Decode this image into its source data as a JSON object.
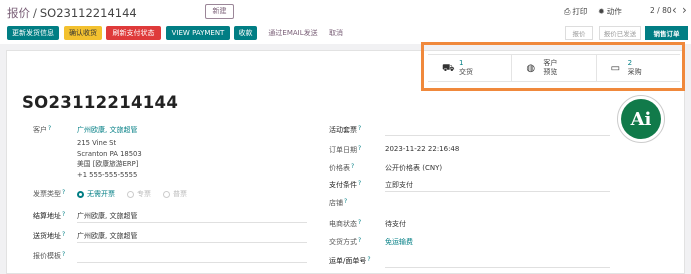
{
  "breadcrumb": {
    "parent": "报价",
    "sep": "/",
    "current": "SO23112214144"
  },
  "new_button": "新建",
  "toolbar": {
    "print_icon": "printer-icon",
    "print": "打印",
    "action_icon": "gear-icon",
    "action": "动作",
    "pager": "2 / 80"
  },
  "actions": [
    {
      "label": "更新发货信息",
      "style": "teal"
    },
    {
      "label": "确认收货",
      "style": "yellow"
    },
    {
      "label": "刷新支付状态",
      "style": "red"
    },
    {
      "label": "VIEW PAYMENT",
      "style": "teal"
    },
    {
      "label": "收款",
      "style": "teal"
    },
    {
      "label": "通过EMAIL发送",
      "style": "plain"
    },
    {
      "label": "取消",
      "style": "plain"
    }
  ],
  "statusbar": {
    "quotation": "报价",
    "quotation_sent": "报价已发送",
    "sale_order": "销售订单"
  },
  "smart_buttons": {
    "delivery": {
      "icon": "truck-icon",
      "count": "1",
      "label": "交货"
    },
    "portal": {
      "icon": "globe-icon",
      "line1": "客户",
      "line2": "预览"
    },
    "purchase": {
      "icon": "credit-card-icon",
      "count": "2",
      "label": "采购"
    }
  },
  "order": {
    "name": "SO23112214144",
    "customer_label": "客户",
    "customer": "广州欧康, 文旅超管",
    "address": [
      "215 Vine St",
      "Scranton PA 18503",
      "美国 [欧康旅游ERP]",
      "+1 555-555-5555"
    ],
    "invoice_type_label": "发票类型",
    "invoice_types": [
      "无需开票",
      "专票",
      "普票"
    ],
    "invoice_address_label": "结算地址",
    "invoice_address": "广州欧康, 文旅超管",
    "shipping_address_label": "送货地址",
    "shipping_address": "广州欧康, 文旅超管",
    "quote_template_label": "报价模板",
    "activity_label": "活动套票",
    "order_date_label": "订单日期",
    "order_date": "2023-11-22 22:16:48",
    "pricelist_label": "价格表",
    "pricelist": "公开价格表 (CNY)",
    "payment_terms_label": "支付条件",
    "payment_terms": "立即支付",
    "store_label": "店铺",
    "ecom_status_label": "电商状态",
    "ecom_status": "待支付",
    "delivery_method_label": "交货方式",
    "delivery_method": "免运输费",
    "tracking_label": "运单/面单号"
  },
  "logo": {
    "text": "Ai"
  },
  "colors": {
    "primary": "#017e84",
    "brand": "#7a5f77",
    "highlight": "#f0893c",
    "confirm": "#f3c12f",
    "refresh": "#df3a3a"
  }
}
